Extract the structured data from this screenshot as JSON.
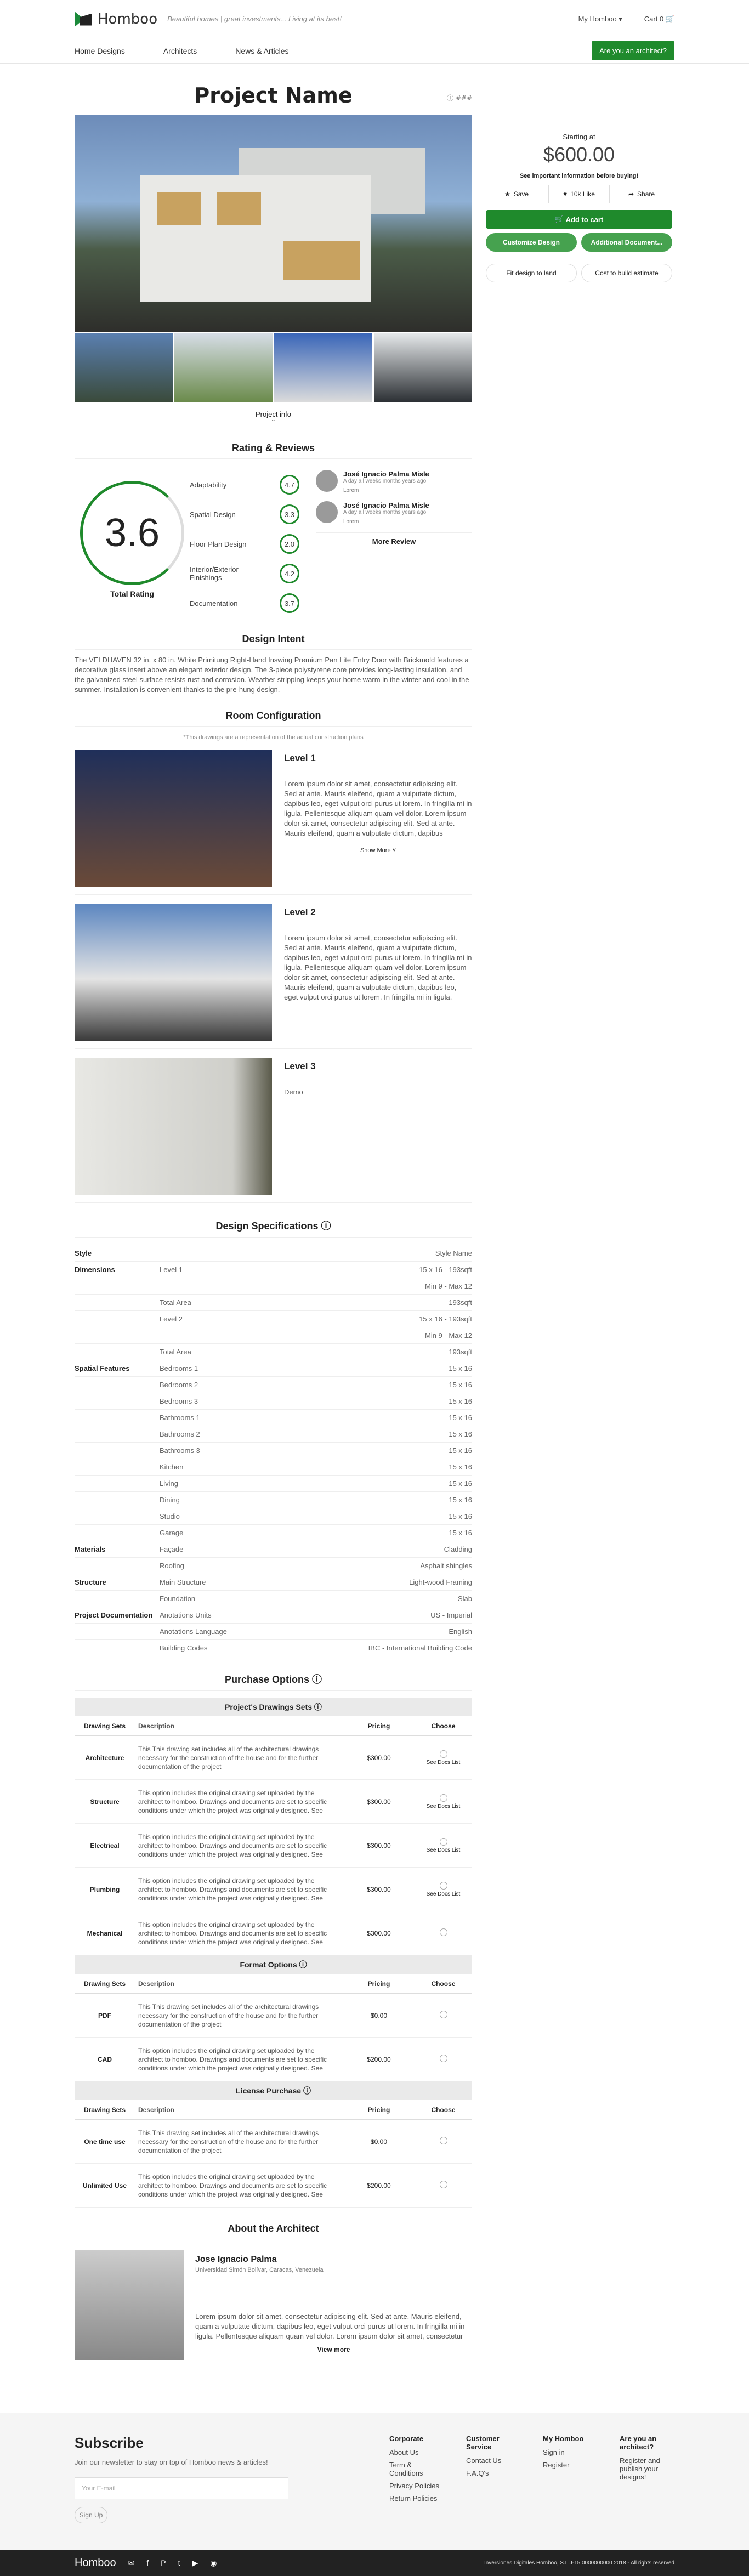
{
  "header": {
    "brand": "Homboo",
    "tagline": "Beautiful homes | great investments... Living at its best!",
    "account": "My Homboo ▾",
    "cart": "Cart 0 🛒"
  },
  "nav": {
    "items": [
      "Home Designs",
      "Architects",
      "News & Articles"
    ],
    "cta": "Are you an architect?"
  },
  "project": {
    "title": "Project Name",
    "id": "ⓘ ###",
    "info": "Project info",
    "chev": "ˇ"
  },
  "sidebar": {
    "starting": "Starting at",
    "price": "$600.00",
    "important": "See important information before buying!",
    "save": "Save",
    "like": "10k Like",
    "share": "Share",
    "add": "Add to cart",
    "customize": "Customize Design",
    "additional": "Additional Document...",
    "fit": "Fit design to land",
    "cost": "Cost to build estimate"
  },
  "rating": {
    "title": "Rating & Reviews",
    "score": "3.6",
    "total": "Total Rating",
    "cats": [
      {
        "label": "Adaptability",
        "v": "4.7"
      },
      {
        "label": "Spatial Design",
        "v": "3.3"
      },
      {
        "label": "Floor Plan Design",
        "v": "2.0"
      },
      {
        "label": "Interior/Exterior Finishings",
        "v": "4.2"
      },
      {
        "label": "Documentation",
        "v": "3.7"
      }
    ],
    "reviews": [
      {
        "name": "José Ignacio Palma Misle",
        "date": "A day all weeks months years ago",
        "text": "Lorem"
      },
      {
        "name": "José Ignacio Palma Misle",
        "date": "A day all weeks months years ago",
        "text": "Lorem"
      }
    ],
    "more": "More Review"
  },
  "intent": {
    "title": "Design Intent",
    "text": "The VELDHAVEN 32 in. x 80 in. White Primitung Right-Hand Inswing Premium Pan Lite Entry Door with Brickmold features a decorative glass insert above an elegant exterior design. The 3-piece polystyrene core provides long-lasting insulation, and the galvanized steel surface resists rust and corrosion. Weather stripping keeps your home warm in the winter and cool in the summer. Installation is convenient thanks to the pre-hung design."
  },
  "rooms": {
    "title": "Room Configuration",
    "note": "*This drawings are a representation of the actual construction plans",
    "showmore": "Show More ˅",
    "levels": [
      {
        "name": "Level 1",
        "text": "Lorem ipsum dolor sit amet, consectetur adipiscing elit. Sed at ante. Mauris eleifend, quam a vulputate dictum, dapibus leo, eget vulput orci purus ut lorem. In fringilla mi in ligula. Pellentesque aliquam quam vel dolor. Lorem ipsum dolor sit amet, consectetur adipiscing elit. Sed at ante. Mauris eleifend, quam a vulputate dictum, dapibus"
      },
      {
        "name": "Level 2",
        "text": "Lorem ipsum dolor sit amet, consectetur adipiscing elit. Sed at ante. Mauris eleifend, quam a vulputate dictum, dapibus leo, eget vulput orci purus ut lorem. In fringilla mi in ligula. Pellentesque aliquam quam vel dolor. Lorem ipsum dolor sit amet, consectetur adipiscing elit. Sed at ante. Mauris eleifend, quam a vulputate dictum, dapibus leo, eget vulput orci purus ut lorem. In fringilla mi in ligula."
      },
      {
        "name": "Level 3",
        "text": "Demo"
      }
    ]
  },
  "specs": {
    "title": "Design Specifications ⓘ",
    "rows": [
      [
        "Style",
        "",
        "Style Name"
      ],
      [
        "Dimensions",
        "Level 1",
        "15 x 16 - 193sqft"
      ],
      [
        "",
        "",
        "Min 9 - Max 12"
      ],
      [
        "",
        "Total Area",
        "193sqft"
      ],
      [
        "",
        "Level 2",
        "15 x 16 - 193sqft"
      ],
      [
        "",
        "",
        "Min 9 - Max 12"
      ],
      [
        "",
        "Total Area",
        "193sqft"
      ],
      [
        "Spatial Features",
        "Bedrooms 1",
        "15 x 16"
      ],
      [
        "",
        "Bedrooms 2",
        "15 x 16"
      ],
      [
        "",
        "Bedrooms 3",
        "15 x 16"
      ],
      [
        "",
        "Bathrooms 1",
        "15 x 16"
      ],
      [
        "",
        "Bathrooms 2",
        "15 x 16"
      ],
      [
        "",
        "Bathrooms 3",
        "15 x 16"
      ],
      [
        "",
        "Kitchen",
        "15 x 16"
      ],
      [
        "",
        "Living",
        "15 x 16"
      ],
      [
        "",
        "Dining",
        "15 x 16"
      ],
      [
        "",
        "Studio",
        "15 x 16"
      ],
      [
        "",
        "Garage",
        "15 x 16"
      ],
      [
        "Materials",
        "Façade",
        "Cladding"
      ],
      [
        "",
        "Roofing",
        "Asphalt shingles"
      ],
      [
        "Structure",
        "Main Structure",
        "Light-wood Framing"
      ],
      [
        "",
        "Foundation",
        "Slab"
      ],
      [
        "Project Documentation",
        "Anotations Units",
        "US - Imperial"
      ],
      [
        "",
        "Anotations Language",
        "English"
      ],
      [
        "",
        "Building Codes",
        "IBC - International Building Code"
      ]
    ]
  },
  "purchase": {
    "title": "Purchase Options ⓘ",
    "heads": [
      "Drawing Sets",
      "Description",
      "Pricing",
      "Choose"
    ],
    "drawing_band": "Project's Drawings Sets ⓘ",
    "drawing": [
      [
        "Architecture",
        "This This drawing set includes all of the architectural drawings necessary for the construction of the house and for the further documentation of the project",
        "$300.00",
        "See Docs List"
      ],
      [
        "Structure",
        "This option includes the original drawing set uploaded by the architect to homboo. Drawings and documents are set to specific conditions under which the project was originally designed. See",
        "$300.00",
        "See Docs List"
      ],
      [
        "Electrical",
        "This option includes the original drawing set uploaded by the architect to homboo. Drawings and documents are set to specific conditions under which the project was originally designed. See",
        "$300.00",
        "See Docs List"
      ],
      [
        "Plumbing",
        "This option includes the original drawing set uploaded by the architect to homboo. Drawings and documents are set to specific conditions under which the project was originally designed. See",
        "$300.00",
        "See Docs List"
      ],
      [
        "Mechanical",
        "This option includes the original drawing set uploaded by the architect to homboo. Drawings and documents are set to specific conditions under which the project was originally designed. See",
        "$300.00",
        ""
      ]
    ],
    "format_band": "Format Options ⓘ",
    "format": [
      [
        "PDF",
        "This This drawing set includes all of the architectural drawings necessary for the construction of the house and for the further documentation of the project",
        "$0.00",
        ""
      ],
      [
        "CAD",
        "This option includes the original drawing set uploaded by the architect to homboo. Drawings and documents are set to specific conditions under which the project was originally designed. See",
        "$200.00",
        ""
      ]
    ],
    "license_band": "License Purchase ⓘ",
    "license": [
      [
        "One time use",
        "This This drawing set includes all of the architectural drawings necessary for the construction of the house and for the further documentation of the project",
        "$0.00",
        ""
      ],
      [
        "Unlimited Use",
        "This option includes the original drawing set uploaded by the architect to homboo. Drawings and documents are set to specific conditions under which the project was originally designed. See",
        "$200.00",
        ""
      ]
    ]
  },
  "architect": {
    "title": "About the Architect",
    "name": "Jose Ignacio Palma",
    "uni": "Universidad Simón Bolívar, Caracas, Venezuela",
    "text": "Lorem ipsum dolor sit amet, consectetur adipiscing elit. Sed at ante. Mauris eleifend, quam a vulputate dictum, dapibus leo, eget vulput orci purus ut lorem. In fringilla mi in ligula. Pellentesque aliquam quam vel dolor. Lorem ipsum dolor sit amet, consectetur",
    "view": "View more"
  },
  "footer": {
    "subscribe": "Subscribe",
    "subtext": "Join our newsletter to stay on top of Homboo news & articles!",
    "email": "Your E-mail",
    "signup": "Sign Up",
    "cols": [
      {
        "h": "Corporate",
        "items": [
          "About Us",
          "Term & Conditions",
          "Privacy Policies",
          "Return Policies"
        ]
      },
      {
        "h": "Customer Service",
        "items": [
          "Contact Us",
          "F.A.Q's"
        ]
      },
      {
        "h": "My Homboo",
        "items": [
          "Sign in",
          "Register"
        ]
      },
      {
        "h": "Are you an architect?",
        "items": [
          "Register and publish your designs!"
        ]
      }
    ],
    "brand": "Homboo",
    "copy": "Inversiones Digitales Homboo, S.L J-15 0000000000 2018 - All rights reserved"
  }
}
